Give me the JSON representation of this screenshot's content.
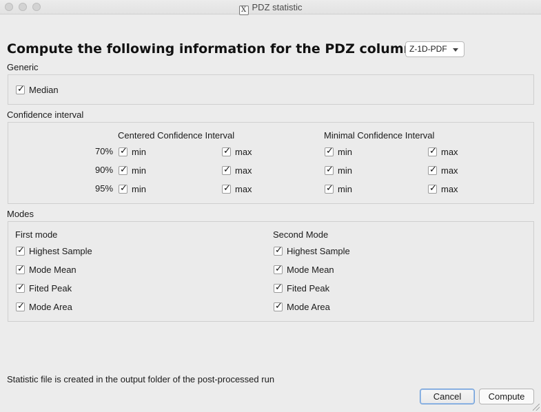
{
  "window": {
    "title": "PDZ statistic",
    "app_icon": "X"
  },
  "header": {
    "heading": "Compute the following information for the PDZ column:",
    "column_select": {
      "value": "Z-1D-PDF"
    }
  },
  "generic": {
    "label": "Generic",
    "median": {
      "label": "Median",
      "checked": true
    }
  },
  "confidence": {
    "label": "Confidence interval",
    "centered_title": "Centered Confidence Interval",
    "minimal_title": "Minimal Confidence Interval",
    "min_label": "min",
    "max_label": "max",
    "rows": [
      {
        "level": "70%"
      },
      {
        "level": "90%"
      },
      {
        "level": "95%"
      }
    ]
  },
  "modes": {
    "label": "Modes",
    "first_title": "First mode",
    "second_title": "Second Mode",
    "items": [
      "Highest Sample",
      "Mode Mean",
      "Fited Peak",
      "Mode Area"
    ]
  },
  "footer": {
    "info": "Statistic file is created in the output folder of the  post-processed run",
    "cancel": "Cancel",
    "compute": "Compute"
  }
}
